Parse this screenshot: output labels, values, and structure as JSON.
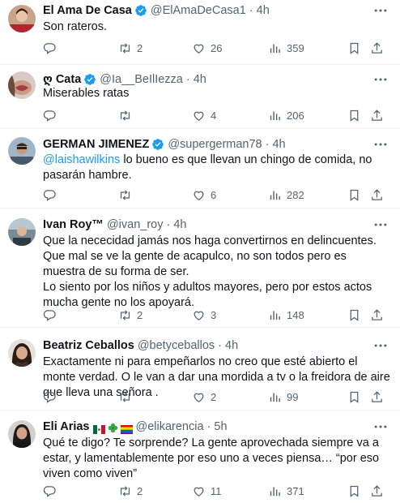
{
  "tweets": [
    {
      "name": "El Ama De Casa",
      "handle": "@ElAmaDeCasa1",
      "time": "4h",
      "text": "Son rateros.",
      "retweets": "2",
      "likes": "26",
      "views": "359"
    },
    {
      "name": "ღ Cata",
      "handle": "@Ia__BeIlIezza",
      "time": "4h",
      "text": "Miserables ratas",
      "retweets": "",
      "likes": "4",
      "views": "206"
    },
    {
      "name": "GERMAN JIMENEZ",
      "handle": "@supergerman78",
      "time": "4h",
      "mention": "@laishawilkins",
      "text": " lo bueno es que llevan un chingo de comida, no pasarán hambre.",
      "retweets": "",
      "likes": "6",
      "views": "282"
    },
    {
      "name": "Ivan Roy™",
      "handle": "@ivan_roy",
      "time": "4h",
      "text": "Que la nececidad jamás nos haga convertirnos en delincuentes.\nQue mal se ve la gente de acapulco, no son todos pero  es muestra de su forma de ser.\nLo siento por los niños y adultos mayores, pero por estos actos mucha gente no los apoyará.",
      "retweets": "2",
      "likes": "3",
      "views": "148"
    },
    {
      "name": "Beatriz Ceballos",
      "handle": "@betyceballos",
      "time": "4h",
      "text": "Exactamente ni para empeñarlos no creo que esté abierto el monte verdad. O le van a dar una mordida a tv o la freidora de aire que lleva una señora .",
      "retweets": "",
      "likes": "2",
      "views": "99"
    },
    {
      "name": "Eli Arias",
      "handle": "@elikarencia",
      "time": "5h",
      "text": "Qué te digo? Te sorprende? La gente aprovechada siempre va a estar, y lamentablemente por eso uno a veces piensa… “por eso viven como viven”\n.",
      "retweets": "2",
      "likes": "11",
      "views": "371"
    }
  ],
  "icons": {
    "verified": "verified-badge-icon",
    "more": "more-dots-icon",
    "reply": "reply-icon",
    "retweet": "retweet-icon",
    "like": "heart-icon",
    "views": "views-chart-icon",
    "bookmark": "bookmark-icon",
    "share": "share-icon"
  },
  "colors": {
    "text": "#0f1419",
    "secondary": "#536471",
    "link": "#1d9bf0",
    "verified": "#1d9bf0",
    "divider": "#eff3f4"
  }
}
